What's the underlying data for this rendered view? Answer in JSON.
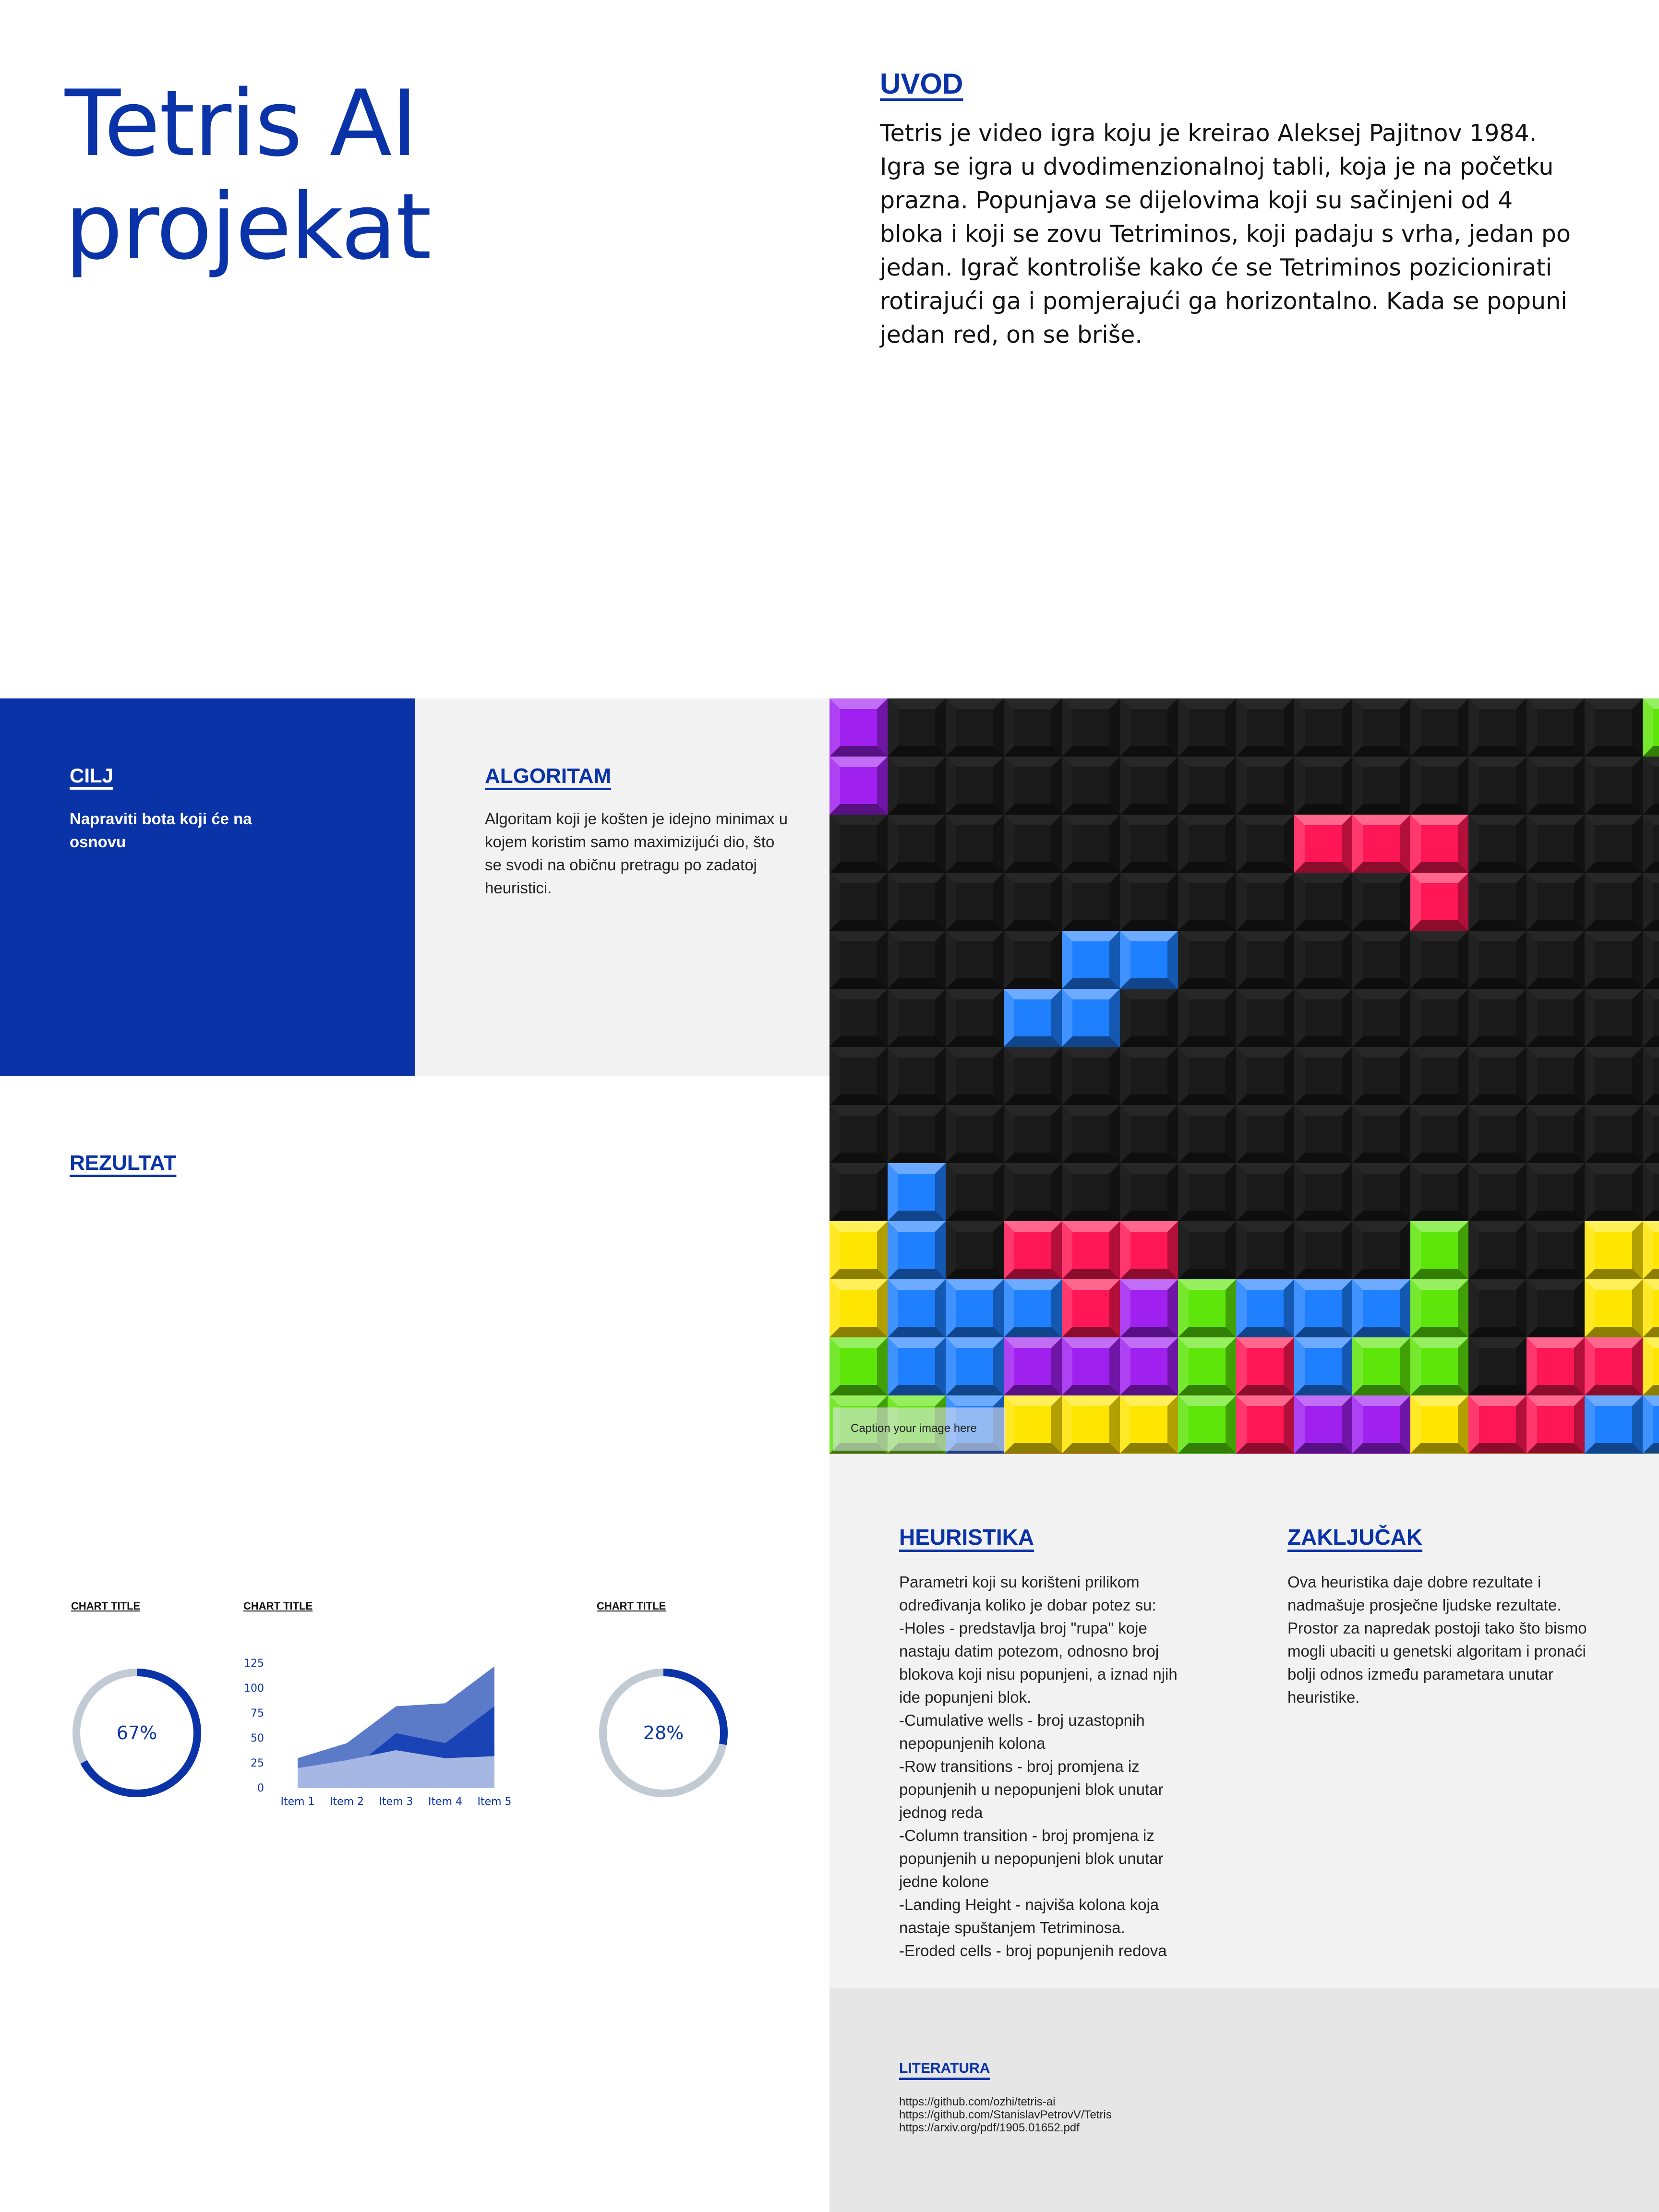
{
  "title": "Tetris AI projekat",
  "uvod": {
    "title": "UVOD",
    "text": "Tetris je video igra koju je kreirao Aleksej Pajitnov 1984.\nIgra se igra u dvodimenzionalnoj tabli, koja je na početku prazna. Popunjava se dijelovima koji su sačinjeni od 4 bloka i koji se zovu Tetriminos, koji padaju s vrha, jedan po jedan. Igrač kontroliše kako će se Tetriminos pozicionirati rotirajući ga i pomjerajući ga horizontalno. Kada se popuni jedan red, on se briše."
  },
  "cilj": {
    "title": "CILJ",
    "text": "Napraviti bota koji će na osnovu"
  },
  "algoritam": {
    "title": "ALGORITAM",
    "text": "Algoritam koji je košten je idejno minimax u kojem koristim samo maximizijući dio, što se svodi na običnu pretragu po zadatoj heuristici."
  },
  "image": {
    "caption": "Caption your image here",
    "colors": {
      "empty": "#1a1a1a",
      "purple": "#a020f0",
      "pink": "#ff1654",
      "blue": "#1e7fff",
      "yellow": "#ffe600",
      "green": "#5ee60a"
    },
    "grid": [
      "P.............G",
      "P..............",
      "........KKK....",
      "..........K....",
      "....BB.........",
      "...BB..........",
      "...............",
      "...............",
      ".B.............",
      "YB.KKK....G..YY",
      "YBBBKPGBBBG..YY",
      "GBBPPPGKBGG.KKY",
      "GGBYYYGKPPYKKBB",
      "KKKKKYGKPPYYYBY"
    ]
  },
  "rezultat": {
    "title": "REZULTAT"
  },
  "charts_section": {
    "chart1_title": "CHART TITLE",
    "chart2_title": "CHART TITLE",
    "chart3_title": "CHART TITLE",
    "donut1_label": "67%",
    "donut2_label": "28%"
  },
  "chart_data": [
    {
      "type": "pie",
      "title": "CHART TITLE",
      "values": [
        67,
        33
      ],
      "label": "67%",
      "colors": [
        "#0a33a8",
        "#c2cbd4"
      ]
    },
    {
      "type": "area",
      "title": "CHART TITLE",
      "categories": [
        "Item 1",
        "Item 2",
        "Item 3",
        "Item 4",
        "Item 5"
      ],
      "y_ticks": [
        "0",
        "25",
        "50",
        "75",
        "100",
        "125"
      ],
      "ylim": [
        0,
        125
      ],
      "series": [
        {
          "values": [
            30,
            45,
            82,
            85,
            122
          ],
          "color": "#5b7ac8"
        },
        {
          "values": [
            8,
            15,
            55,
            45,
            82
          ],
          "color": "#1a44b5"
        },
        {
          "values": [
            20,
            28,
            38,
            30,
            32
          ],
          "color": "#a7b7e3"
        }
      ]
    },
    {
      "type": "pie",
      "title": "CHART TITLE",
      "values": [
        28,
        72
      ],
      "label": "28%",
      "colors": [
        "#0a33a8",
        "#c2cbd4"
      ]
    }
  ],
  "heuristika": {
    "title": "HEURISTIKA",
    "text": "Parametri koji su korišteni prilikom određivanja koliko je dobar potez su:\n-Holes - predstavlja broj \"rupa\" koje nastaju datim potezom, odnosno broj blokova koji nisu popunjeni, a iznad njih ide popunjeni blok.\n-Cumulative wells - broj uzastopnih nepopunjenih kolona\n-Row transitions - broj promjena iz popunjenih u nepopunjeni blok unutar jednog reda\n-Column transition - broj promjena iz popunjenih u nepopunjeni blok unutar jedne kolone\n-Landing Height - najviša kolona koja nastaje spuštanjem Tetriminosa.\n-Eroded cells - broj popunjenih redova"
  },
  "zakljucak": {
    "title": "ZAKLJUČAK",
    "text": "Ova heuristika daje dobre rezultate i nadmašuje prosječne ljudske rezultate. Prostor za napredak postoji tako što bismo mogli ubaciti u genetski algoritam i pronaći bolji odnos između parametara unutar heuristike."
  },
  "literatura": {
    "title": "LITERATURA",
    "links": "https://github.com/ozhi/tetris-ai\nhttps://github.com/StanislavPetrovV/Tetris\nhttps://arxiv.org/pdf/1905.01652.pdf"
  }
}
